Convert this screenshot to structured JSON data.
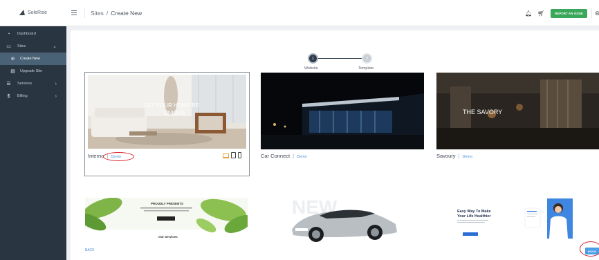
{
  "app": {
    "logo_text": "SoleRise"
  },
  "sidebar": {
    "items": [
      {
        "label": "Dashboard",
        "icon": "dashboard-icon"
      },
      {
        "label": "Sites",
        "icon": "sites-icon",
        "chevron": "⌄"
      },
      {
        "label": "Create New",
        "icon": "create-new-icon"
      },
      {
        "label": "Upgrade Site",
        "icon": "upgrade-icon"
      },
      {
        "label": "Services",
        "icon": "services-icon",
        "chevron": "›"
      },
      {
        "label": "Billing",
        "icon": "billing-icon",
        "chevron": "›"
      }
    ]
  },
  "header": {
    "breadcrumb_root": "Sites",
    "breadcrumb_sep": "/",
    "breadcrumb_current": "Create New",
    "report_button": "REPORT AN ISSUE"
  },
  "stepper": {
    "steps": [
      {
        "number": "1",
        "label": "Website",
        "state": "active"
      },
      {
        "number": "2",
        "label": "Template",
        "state": "inactive"
      }
    ]
  },
  "templates": [
    {
      "name": "Interno",
      "demo": "Demo",
      "thumb_text_1": "LET YOUR HOME BE",
      "thumb_text_2": "UNIQUE",
      "selected": true
    },
    {
      "name": "Car Connect",
      "demo": "Demo"
    },
    {
      "name": "Savoury",
      "demo": "Demo",
      "thumb_text_1": "THE SAVORY"
    },
    {
      "name": "",
      "thumb_text_1": "PROUDLY PRESENTS",
      "thumb_text_2": "Our Services"
    },
    {
      "name": "",
      "thumb_text_1": "NEW"
    },
    {
      "name": "",
      "thumb_text_1": "Easy Way To Make",
      "thumb_text_2": "Your Life Healthier"
    }
  ],
  "footer": {
    "back_label": "BACK",
    "build_label": "BUILD"
  },
  "colors": {
    "sidebar_bg": "#2a3542",
    "sidebar_active": "#4a6275",
    "report_button": "#3ba75a",
    "demo_link": "#4a8fd8",
    "build_button": "#4c9de8",
    "annotation_oval": "#d8242e"
  }
}
